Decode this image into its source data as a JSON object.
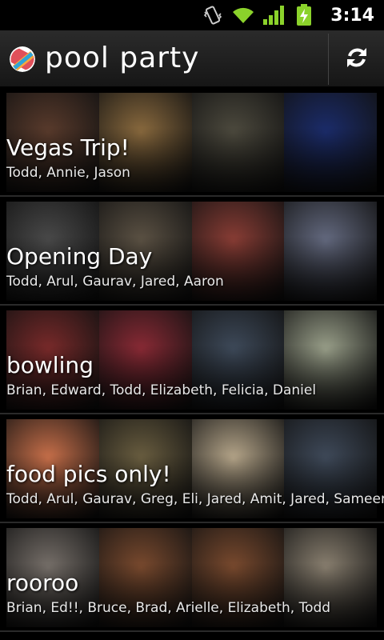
{
  "status_bar": {
    "time": "3:14",
    "icons": [
      "vibrate-icon",
      "wifi-icon",
      "signal-icon",
      "battery-charging-icon"
    ],
    "colors": {
      "wifi": "#8bd22b",
      "signal": "#8bd22b",
      "battery": "#8bd22b"
    }
  },
  "action_bar": {
    "title": "pool party",
    "logo_icon": "app-logo-icon",
    "refresh_icon": "refresh-icon"
  },
  "albums": [
    {
      "title": "Vegas Trip!",
      "people": "Todd, Annie, Jason",
      "thumb_colors": [
        "#5a3b2c",
        "#8a6a3e",
        "#4d4a3e",
        "#1b2c6b"
      ]
    },
    {
      "title": "Opening Day",
      "people": "Todd, Arul, Gaurav, Jared, Aaron",
      "thumb_colors": [
        "#4a4a4a",
        "#5c5244",
        "#8a3d35",
        "#646a80"
      ]
    },
    {
      "title": "bowling",
      "people": "Brian, Edward, Todd, Elizabeth, Felicia, Daniel",
      "thumb_colors": [
        "#7a2a2a",
        "#8a2a35",
        "#3e4a5a",
        "#9aa08a"
      ]
    },
    {
      "title": "food pics only!",
      "people": "Todd, Arul, Gaurav, Greg, Eli, Jared, Amit, Jared, Sameer",
      "thumb_colors": [
        "#c9704a",
        "#6a5e40",
        "#b6a68a",
        "#3f4a5a"
      ]
    },
    {
      "title": "rooroo",
      "people": "Brian, Ed!!, Bruce, Brad, Arielle, Elizabeth, Todd",
      "thumb_colors": [
        "#77706a",
        "#7a4a2e",
        "#7a4a2e",
        "#8a8070"
      ]
    }
  ]
}
